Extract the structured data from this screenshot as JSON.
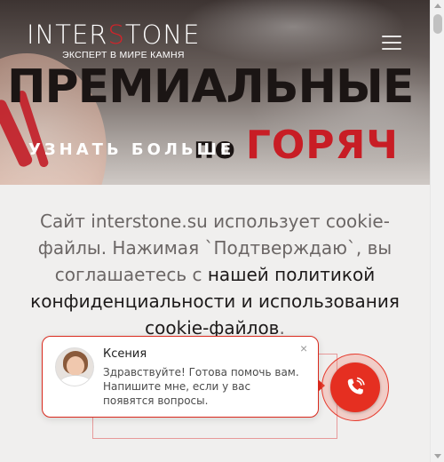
{
  "header": {
    "logo_part1": "INTER",
    "logo_accent": "S",
    "logo_part2": "TONE",
    "tagline": "ЭКСПЕРТ В МИРЕ КАМНЯ"
  },
  "hero": {
    "headline": "ПРЕМИАЛЬНЫЕ",
    "cta_label": "УЗНАТЬ БОЛЬШЕ",
    "promo_word": "по",
    "promo_hot": "ГОРЯЧ"
  },
  "cookie": {
    "text_before": "Сайт interstone.su использует cookie-файлы. Нажимая `Подтверждаю`, вы соглашаетесь с ",
    "policy_link": "нашей политикой конфиденциальности и использования cookie-файлов",
    "text_after": "."
  },
  "chat": {
    "close_symbol": "×",
    "agent_name": "Ксения",
    "message": "Здравствуйте! Готова помочь вам. Напишите мне, если у вас появятся вопросы."
  },
  "colors": {
    "accent": "#d2232a",
    "call_button": "#e52f21",
    "popup_border": "#d9291d",
    "cookie_background": "#f0efee"
  },
  "icons": {
    "menu": "hamburger-menu-icon",
    "close": "close-icon",
    "call": "phone-icon"
  }
}
